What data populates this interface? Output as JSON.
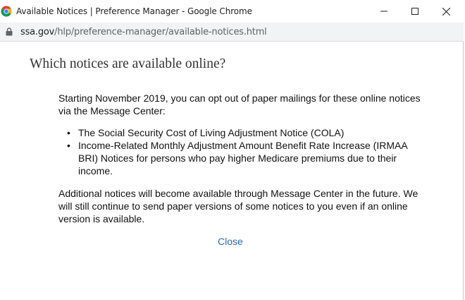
{
  "window": {
    "title": "Available Notices | Preference Manager - Google Chrome",
    "controls": {
      "minimize": "minimize-icon",
      "maximize": "maximize-icon",
      "close": "close-icon"
    }
  },
  "address_bar": {
    "domain": "ssa.gov",
    "path": "/hlp/preference-manager/available-notices.html",
    "icon": "lock-icon"
  },
  "dialog": {
    "heading": "Which notices are available online?",
    "intro": "Starting November 2019, you can opt out of paper mailings for these online notices via the Message Center:",
    "notices": [
      {
        "bullet": "•",
        "text": "The Social Security Cost of Living Adjustment Notice (COLA)"
      },
      {
        "bullet": "•",
        "text": "Income-Related Monthly Adjustment Amount Benefit Rate Increase (IRMAA BRI) Notices for persons who pay higher Medicare premiums due to their income."
      }
    ],
    "outro": "Additional notices will become available through Message Center in the future. We will still continue to send paper versions of some notices to you even if an online version is available.",
    "close_label": "Close"
  },
  "colors": {
    "link": "#2a6ab5",
    "heading": "#333333",
    "address_bar_bg": "#f1f3f4"
  }
}
